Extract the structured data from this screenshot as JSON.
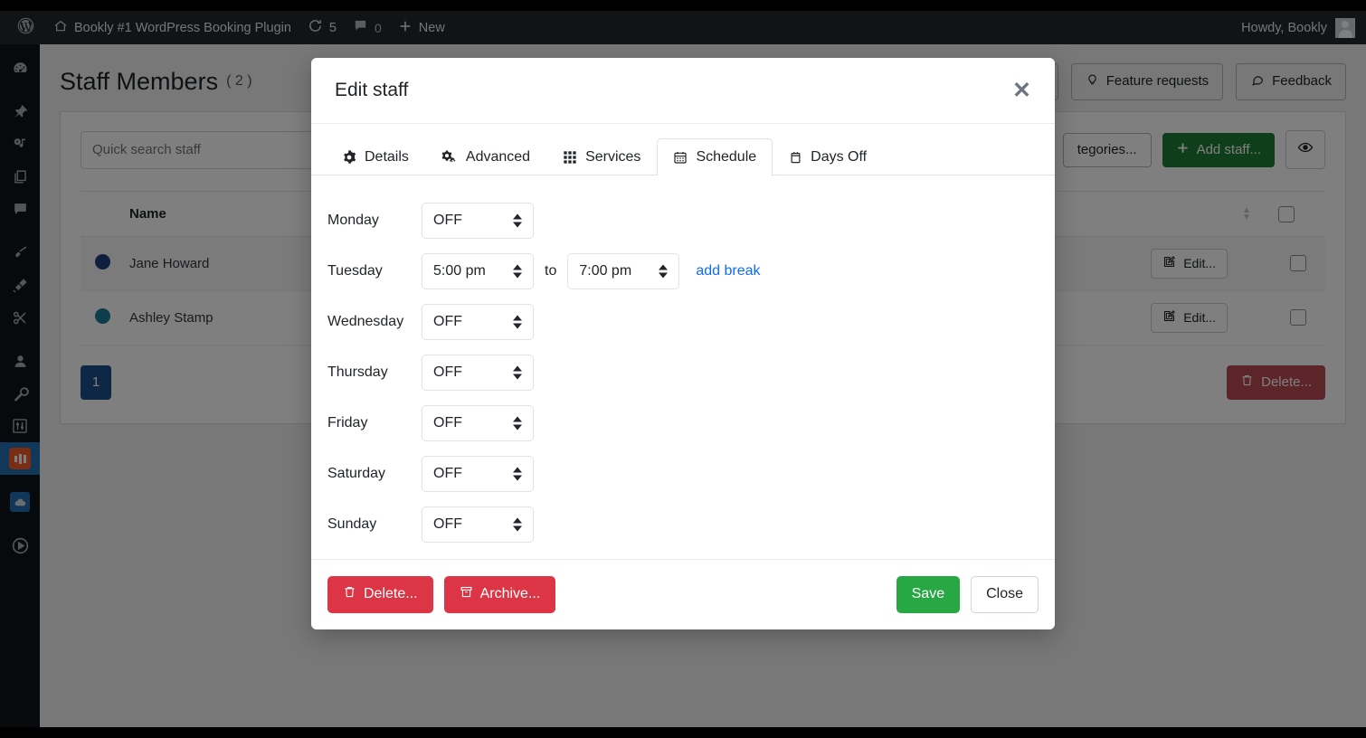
{
  "adminbar": {
    "logo_icon": "wordpress-icon",
    "site_icon": "home-icon",
    "site_name": "Bookly #1 WordPress Booking Plugin",
    "updates_icon": "updates-icon",
    "updates_count": "5",
    "comments_icon": "comment-icon",
    "comments_count": "0",
    "new_icon": "plus-icon",
    "new_label": "New",
    "howdy": "Howdy, Bookly"
  },
  "sidebar": {
    "items": [
      {
        "name": "dashboard",
        "icon": "dashboard-icon"
      },
      {
        "name": "posts",
        "icon": "pin-icon"
      },
      {
        "name": "media",
        "icon": "media-icon"
      },
      {
        "name": "pages",
        "icon": "pages-icon"
      },
      {
        "name": "comments",
        "icon": "comment-icon"
      },
      {
        "name": "appearance",
        "icon": "brush-icon"
      },
      {
        "name": "plugins",
        "icon": "plug-icon"
      },
      {
        "name": "tools-cut",
        "icon": "scissors-icon"
      },
      {
        "name": "users",
        "icon": "user-icon"
      },
      {
        "name": "tools",
        "icon": "wrench-icon"
      },
      {
        "name": "settings",
        "icon": "sliders-icon"
      },
      {
        "name": "bookly",
        "icon": "bookly-icon"
      },
      {
        "name": "cloud",
        "icon": "cloud-icon"
      },
      {
        "name": "player",
        "icon": "play-circle-icon"
      }
    ]
  },
  "page": {
    "title": "Staff Members",
    "count": "( 2 )",
    "feature_requests_label": "Feature requests",
    "feature_requests_icon": "bulb-icon",
    "feedback_label": "Feedback",
    "feedback_icon": "chat-icon",
    "categories_label": "tegories...",
    "add_staff_label": "Add staff...",
    "add_staff_icon": "plus-icon",
    "eye_icon": "eye-icon",
    "search_placeholder": "Quick search staff",
    "columns": [
      "Name"
    ],
    "rows": [
      {
        "name": "Jane Howard",
        "dot_color": "#1f3f7a",
        "edit_label": "Edit...",
        "edit_icon": "edit-icon"
      },
      {
        "name": "Ashley Stamp",
        "dot_color": "#1c7b96",
        "edit_label": "Edit...",
        "edit_icon": "edit-icon"
      }
    ],
    "pager_current": "1",
    "delete_label": "Delete...",
    "delete_icon": "trash-icon"
  },
  "modal": {
    "title": "Edit staff",
    "close_icon": "close-icon",
    "tabs": [
      {
        "label": "Details",
        "icon": "gear-icon",
        "active": false
      },
      {
        "label": "Advanced",
        "icon": "gears-icon",
        "active": false
      },
      {
        "label": "Services",
        "icon": "grid-icon",
        "active": false
      },
      {
        "label": "Schedule",
        "icon": "calendar-icon",
        "active": true
      },
      {
        "label": "Days Off",
        "icon": "calendar-blank-icon",
        "active": false
      }
    ],
    "schedule": {
      "to_label": "to",
      "add_break_label": "add break",
      "rows": [
        {
          "day": "Monday",
          "start": "OFF",
          "end": null,
          "has_range": false
        },
        {
          "day": "Tuesday",
          "start": "5:00 pm",
          "end": "7:00 pm",
          "has_range": true
        },
        {
          "day": "Wednesday",
          "start": "OFF",
          "end": null,
          "has_range": false
        },
        {
          "day": "Thursday",
          "start": "OFF",
          "end": null,
          "has_range": false
        },
        {
          "day": "Friday",
          "start": "OFF",
          "end": null,
          "has_range": false
        },
        {
          "day": "Saturday",
          "start": "OFF",
          "end": null,
          "has_range": false
        },
        {
          "day": "Sunday",
          "start": "OFF",
          "end": null,
          "has_range": false
        }
      ]
    },
    "footer": {
      "delete_label": "Delete...",
      "delete_icon": "trash-icon",
      "archive_label": "Archive...",
      "archive_icon": "archive-icon",
      "save_label": "Save",
      "close_label": "Close"
    }
  },
  "colors": {
    "accent_blue": "#2271b1",
    "bookly_orange": "#f05a28",
    "green": "#28a745",
    "danger_red": "#dc3545",
    "link_blue": "#0d6efd",
    "overlay": "#767676"
  }
}
